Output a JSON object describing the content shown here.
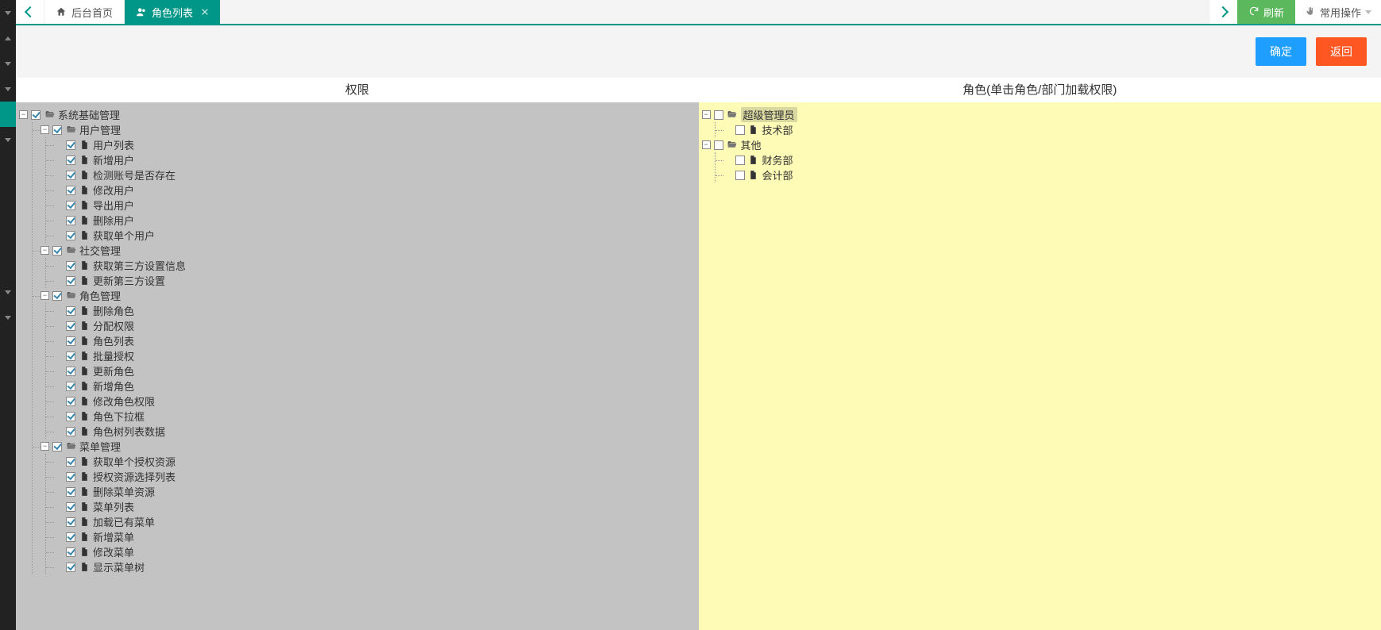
{
  "tabs": {
    "home": "后台首页",
    "active": "角色列表"
  },
  "toolbar": {
    "refresh": "刷新",
    "ops": "常用操作"
  },
  "actions": {
    "ok": "确定",
    "back": "返回"
  },
  "headers": {
    "perm": "权限",
    "role": "角色(单击角色/部门加载权限)"
  },
  "permTree": [
    {
      "label": "系统基础管理",
      "type": "folder",
      "checked": true,
      "expanded": true,
      "children": [
        {
          "label": "用户管理",
          "type": "folder",
          "checked": true,
          "expanded": true,
          "children": [
            {
              "label": "用户列表",
              "type": "file",
              "checked": true
            },
            {
              "label": "新增用户",
              "type": "file",
              "checked": true
            },
            {
              "label": "检测账号是否存在",
              "type": "file",
              "checked": true
            },
            {
              "label": "修改用户",
              "type": "file",
              "checked": true
            },
            {
              "label": "导出用户",
              "type": "file",
              "checked": true
            },
            {
              "label": "删除用户",
              "type": "file",
              "checked": true
            },
            {
              "label": "获取单个用户",
              "type": "file",
              "checked": true
            }
          ]
        },
        {
          "label": "社交管理",
          "type": "folder",
          "checked": true,
          "expanded": true,
          "children": [
            {
              "label": "获取第三方设置信息",
              "type": "file",
              "checked": true
            },
            {
              "label": "更新第三方设置",
              "type": "file",
              "checked": true
            }
          ]
        },
        {
          "label": "角色管理",
          "type": "folder",
          "checked": true,
          "expanded": true,
          "children": [
            {
              "label": "删除角色",
              "type": "file",
              "checked": true
            },
            {
              "label": "分配权限",
              "type": "file",
              "checked": true
            },
            {
              "label": "角色列表",
              "type": "file",
              "checked": true
            },
            {
              "label": "批量授权",
              "type": "file",
              "checked": true
            },
            {
              "label": "更新角色",
              "type": "file",
              "checked": true
            },
            {
              "label": "新增角色",
              "type": "file",
              "checked": true
            },
            {
              "label": "修改角色权限",
              "type": "file",
              "checked": true
            },
            {
              "label": "角色下拉框",
              "type": "file",
              "checked": true
            },
            {
              "label": "角色树列表数据",
              "type": "file",
              "checked": true
            }
          ]
        },
        {
          "label": "菜单管理",
          "type": "folder",
          "checked": true,
          "expanded": true,
          "children": [
            {
              "label": "获取单个授权资源",
              "type": "file",
              "checked": true
            },
            {
              "label": "授权资源选择列表",
              "type": "file",
              "checked": true
            },
            {
              "label": "删除菜单资源",
              "type": "file",
              "checked": true
            },
            {
              "label": "菜单列表",
              "type": "file",
              "checked": true
            },
            {
              "label": "加载已有菜单",
              "type": "file",
              "checked": true
            },
            {
              "label": "新增菜单",
              "type": "file",
              "checked": true
            },
            {
              "label": "修改菜单",
              "type": "file",
              "checked": true
            },
            {
              "label": "显示菜单树",
              "type": "file",
              "checked": true
            }
          ]
        }
      ]
    }
  ],
  "roleTree": [
    {
      "label": "超级管理员",
      "type": "folder",
      "checked": false,
      "expanded": true,
      "highlight": true,
      "children": [
        {
          "label": "技术部",
          "type": "file",
          "checked": false
        }
      ]
    },
    {
      "label": "其他",
      "type": "folder",
      "checked": false,
      "expanded": true,
      "children": [
        {
          "label": "财务部",
          "type": "file",
          "checked": false
        },
        {
          "label": "会计部",
          "type": "file",
          "checked": false
        }
      ]
    }
  ]
}
